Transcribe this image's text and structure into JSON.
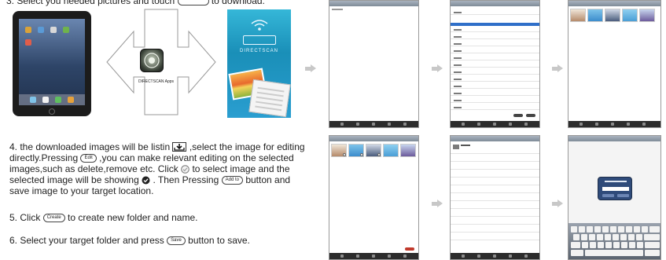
{
  "step3": {
    "text_before": "3. Select you needed pictures and touch",
    "text_after": "to download."
  },
  "app_caption": {
    "name": "DIRECTSCAN",
    "suffix": "Apps"
  },
  "splash": {
    "title": "DIRECTSCAN"
  },
  "step4": {
    "part1": "4. the downloaded images will be listin",
    "part2": ",select the image for editing directly.Pressing",
    "edit_label": "Edit",
    "part3": ",you can make relevant editing on the selected images,such as delete,remove etc. Click",
    "part4": "to select image and the selected image will be showing",
    "part5": ". Then Pressing",
    "addto_label": "Add to",
    "part6": "button and save image to your target location."
  },
  "step5": {
    "before": "5. Click",
    "create_label": "Create",
    "after": "to create new folder and name."
  },
  "step6": {
    "before": "6. Select your target folder and press",
    "save_label": "Save",
    "after": "button to save."
  },
  "colors": {
    "flow_arrow": "#c8c8c8",
    "selection_blue": "#2f6fc9",
    "splash_blue": "#1a8fb8"
  },
  "icons": {
    "download_icon": "download-tray-icon",
    "check_empty_icon": "circle-check-outline-icon",
    "check_filled_icon": "circle-check-filled-icon",
    "wifi_icon": "wifi-icon"
  }
}
